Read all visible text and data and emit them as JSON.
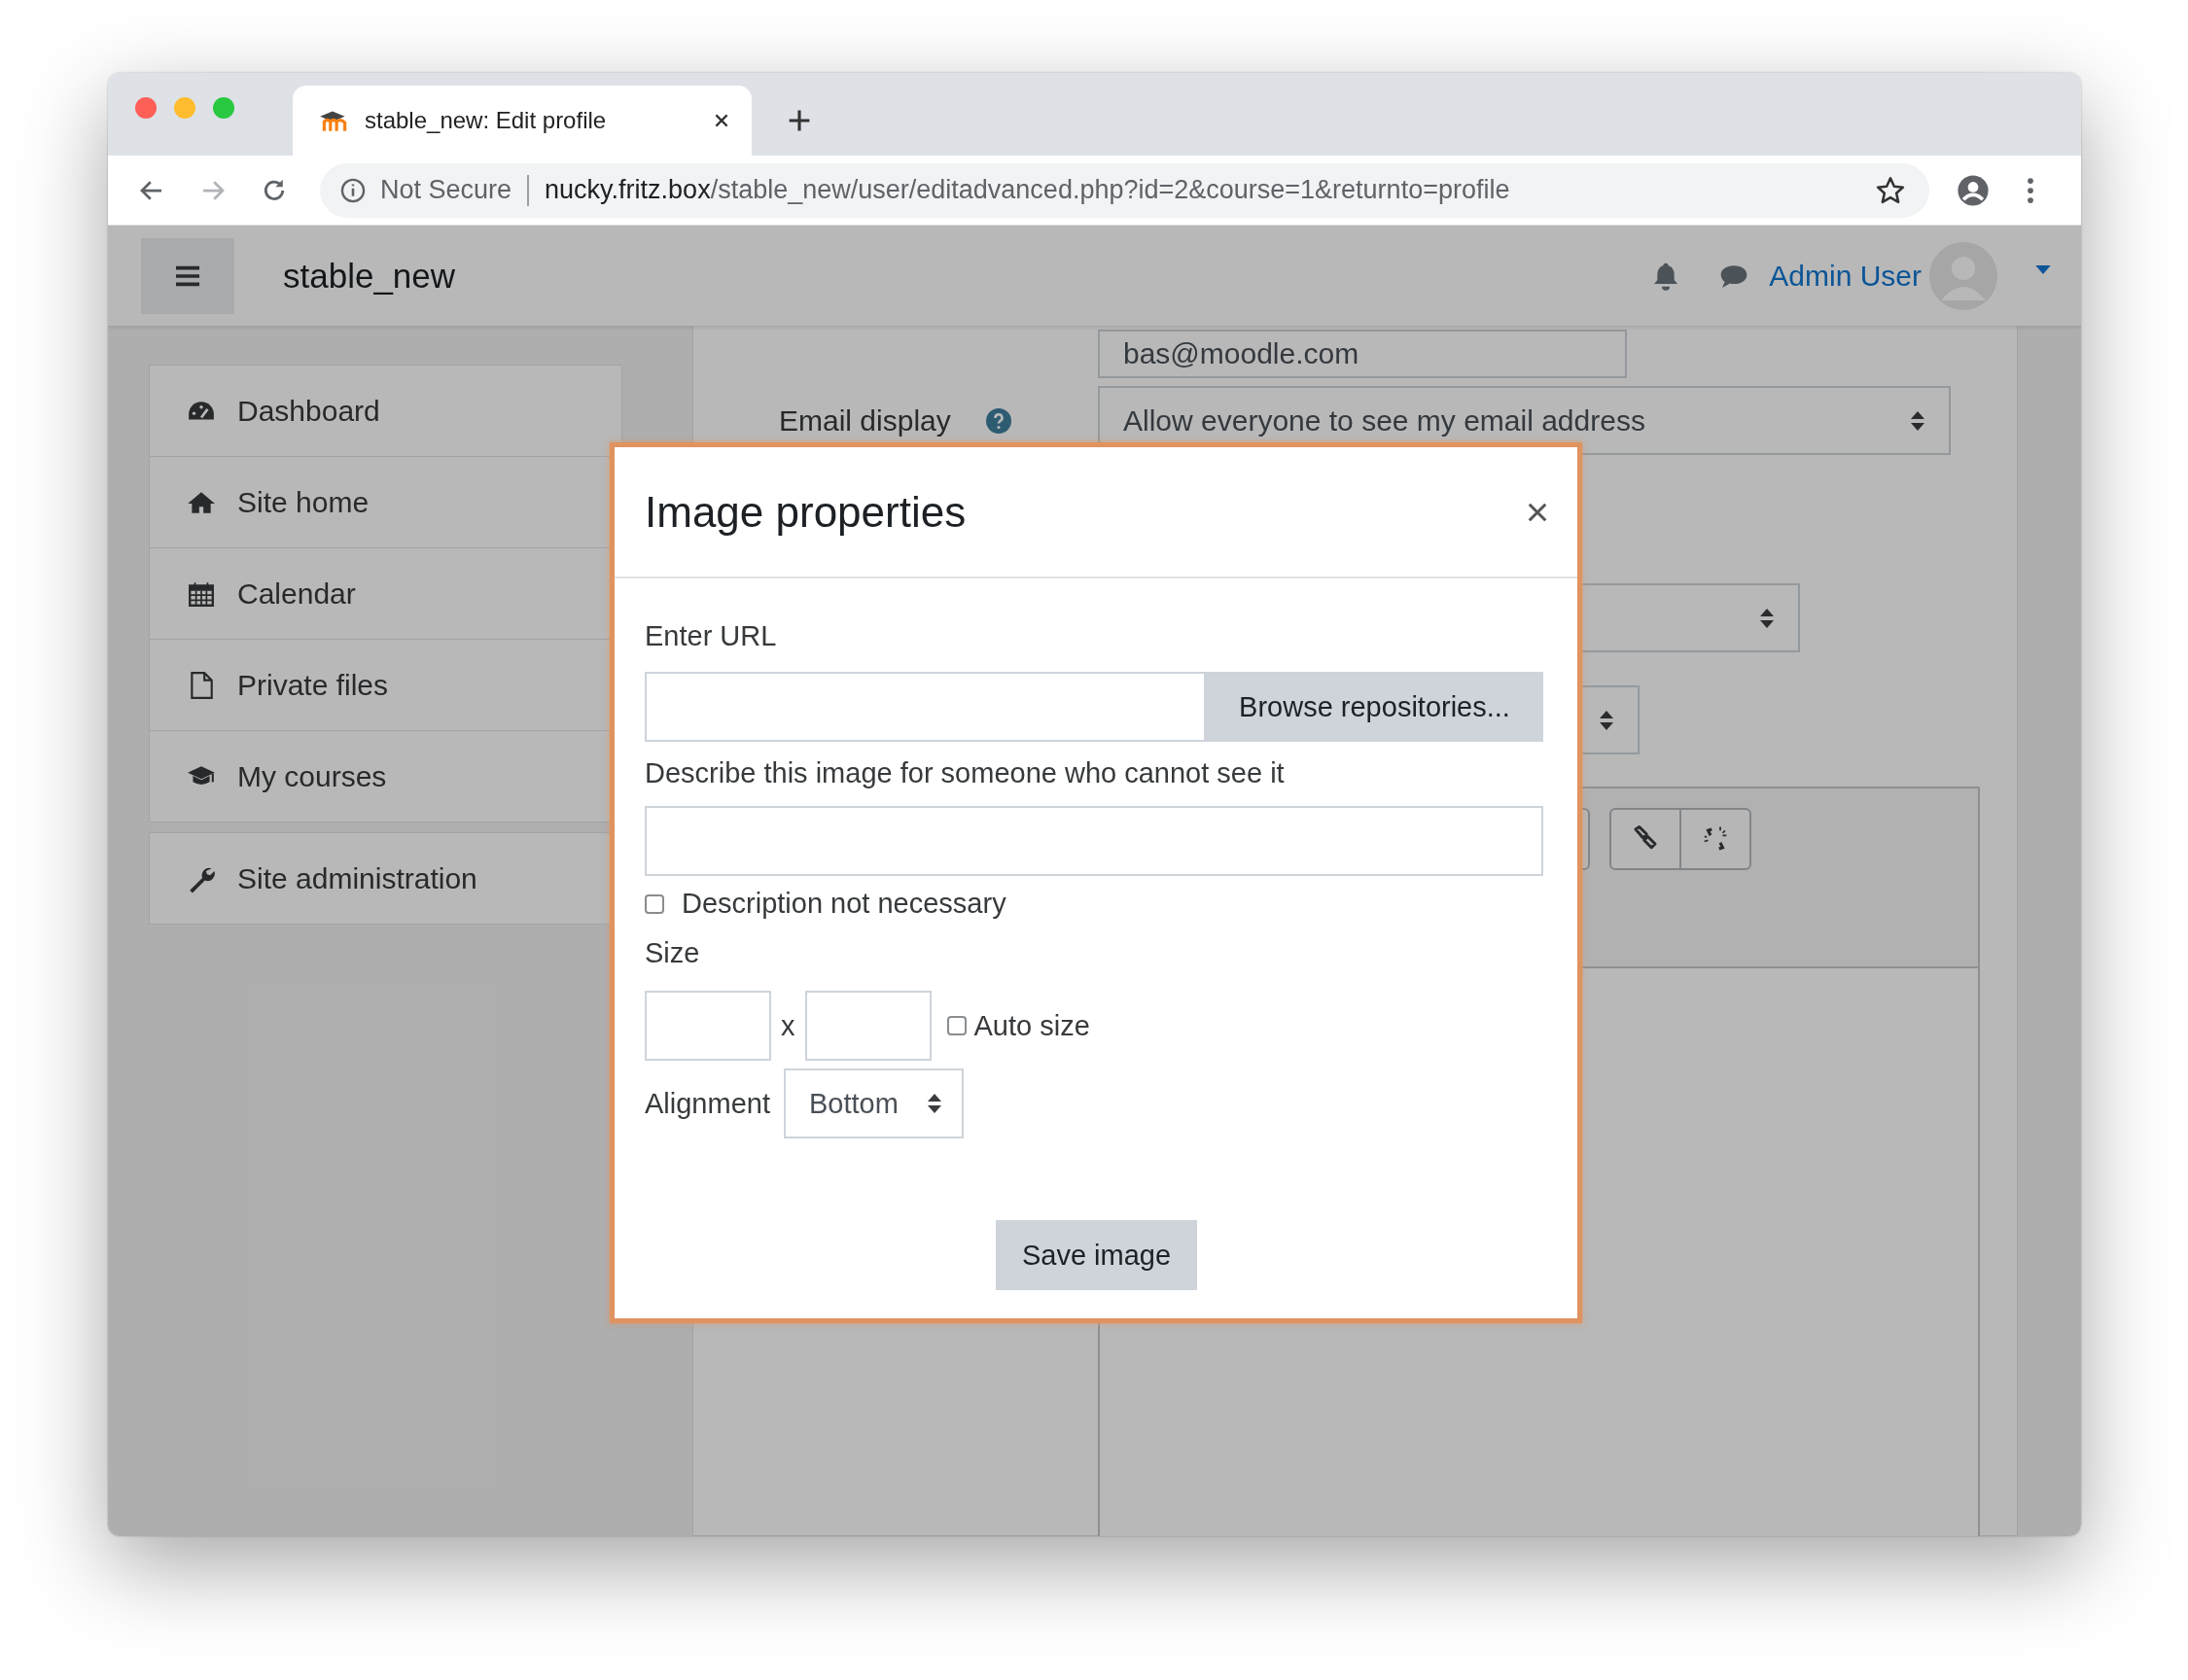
{
  "browser": {
    "tab_title": "stable_new: Edit profile",
    "security": "Not Secure",
    "host": "nucky.fritz.box",
    "path": "/stable_new/user/editadvanced.php?id=2&course=1&returnto=profile"
  },
  "navbar": {
    "site_name": "stable_new",
    "user_name": "Admin User"
  },
  "sidebar": {
    "groups": [
      {
        "items": [
          {
            "kind": "dashboard",
            "label": "Dashboard"
          },
          {
            "kind": "home",
            "label": "Site home"
          },
          {
            "kind": "calendar",
            "label": "Calendar"
          },
          {
            "kind": "file",
            "label": "Private files"
          },
          {
            "kind": "courses",
            "label": "My courses"
          }
        ]
      },
      {
        "items": [
          {
            "kind": "wrench",
            "label": "Site administration"
          }
        ]
      }
    ]
  },
  "form": {
    "email_value": "bas@moodle.com",
    "email_display_label": "Email display",
    "email_display_value": "Allow everyone to see my email address"
  },
  "modal": {
    "title": "Image properties",
    "url_label": "Enter URL",
    "browse_button": "Browse repositories...",
    "description_label": "Describe this image for someone who cannot see it",
    "description_not_necessary": {
      "label": "Description not necessary",
      "checked": false
    },
    "size_label": "Size",
    "size_separator": "x",
    "auto_size": {
      "label": "Auto size",
      "checked": false
    },
    "alignment_label": "Alignment",
    "alignment_value": "Bottom",
    "save_button": "Save image"
  }
}
